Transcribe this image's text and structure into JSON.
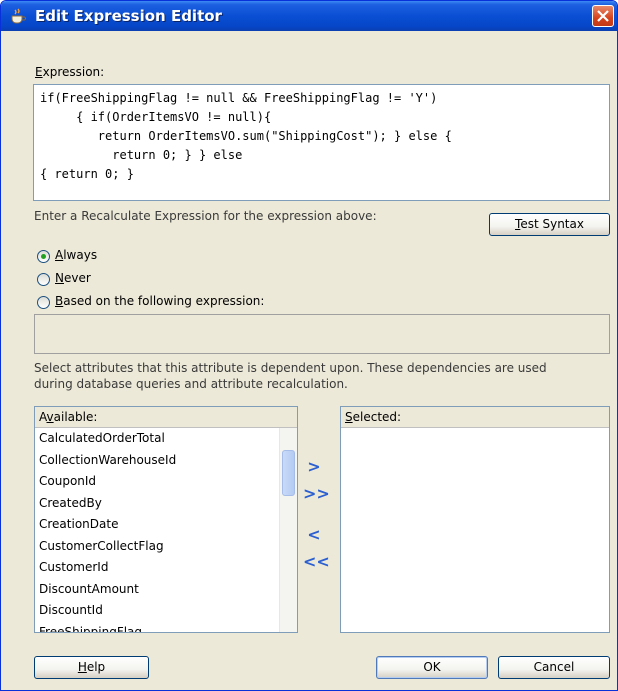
{
  "window": {
    "title": "Edit Expression Editor",
    "accent_color": "#0a4fd4",
    "close_icon": "close-icon"
  },
  "expression": {
    "label": "Expression:",
    "mnemonic": "E",
    "label_rest": "xpression:",
    "lines": [
      "if(FreeShippingFlag != null && FreeShippingFlag != 'Y')",
      "     { if(OrderItemsVO != null){",
      "        return OrderItemsVO.sum(\"ShippingCost\"); } else {",
      "          return 0; } } else",
      "{ return 0; }"
    ]
  },
  "recalc": {
    "prompt": "Enter a Recalculate Expression for the expression above:",
    "test_syntax_mn": "T",
    "test_syntax_rest": "est Syntax",
    "options": [
      {
        "mn": "A",
        "rest": "lways",
        "checked": true
      },
      {
        "mn": "N",
        "rest": "ever",
        "checked": false
      },
      {
        "mn": "B",
        "rest": "ased on the following expression:",
        "checked": false
      }
    ],
    "expression_value": ""
  },
  "dependencies": {
    "description_line1": "Select attributes that this attribute is dependent upon. These dependencies are used",
    "description_line2": "during database queries and attribute recalculation.",
    "available_pre": "A",
    "available_mn": "v",
    "available_rest": "ailable:",
    "selected_mn": "S",
    "selected_rest": "elected:",
    "available_items": [
      "CalculatedOrderTotal",
      "CollectionWarehouseId",
      "CouponId",
      "CreatedBy",
      "CreationDate",
      "CustomerCollectFlag",
      "CustomerId",
      "DiscountAmount",
      "DiscountId",
      "FreeShippingFlag"
    ],
    "selected_items": [],
    "transfer_buttons": [
      ">",
      ">>",
      "<",
      "<<"
    ]
  },
  "footer": {
    "help_mn": "H",
    "help_rest": "elp",
    "ok_label": "OK",
    "cancel_label": "Cancel"
  }
}
